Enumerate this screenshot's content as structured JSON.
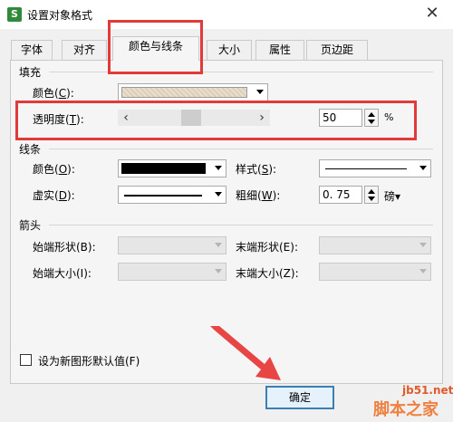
{
  "window": {
    "title": "设置对象格式",
    "app_icon": "S",
    "close": "✕"
  },
  "tabs": [
    "字体",
    "对齐",
    "颜色与线条",
    "大小",
    "属性",
    "页边距"
  ],
  "active_tab": "颜色与线条",
  "fill": {
    "section": "填充",
    "color_label": "颜色(",
    "color_key": "C",
    "color_label_end": "):",
    "transparency_label": "透明度(",
    "transparency_key": "T",
    "transparency_label_end": "):",
    "transparency_value": "50",
    "transparency_unit": "%",
    "slider_left": "‹",
    "slider_right": "›"
  },
  "line": {
    "section": "线条",
    "color_label": "颜色(",
    "color_key": "O",
    "color_label_end": "):",
    "style_label": "样式(",
    "style_key": "S",
    "style_label_end": "):",
    "dash_label": "虚实(",
    "dash_key": "D",
    "dash_label_end": "):",
    "weight_label": "粗细(",
    "weight_key": "W",
    "weight_label_end": "):",
    "weight_value": "0. 75",
    "weight_unit": "磅▾"
  },
  "arrows": {
    "section": "箭头",
    "begin_style": "始端形状(B):",
    "end_style": "末端形状(E):",
    "begin_size": "始端大小(I):",
    "end_size": "末端大小(Z):"
  },
  "default_checkbox_label": "设为新图形默认值(F)",
  "ok_label": "确定",
  "watermark": {
    "site": "jb51.net",
    "name": "脚本之家"
  },
  "colors": {
    "highlight": "#e03a3a",
    "arrow": "#e84545",
    "ok_border": "#3c7fb1"
  }
}
